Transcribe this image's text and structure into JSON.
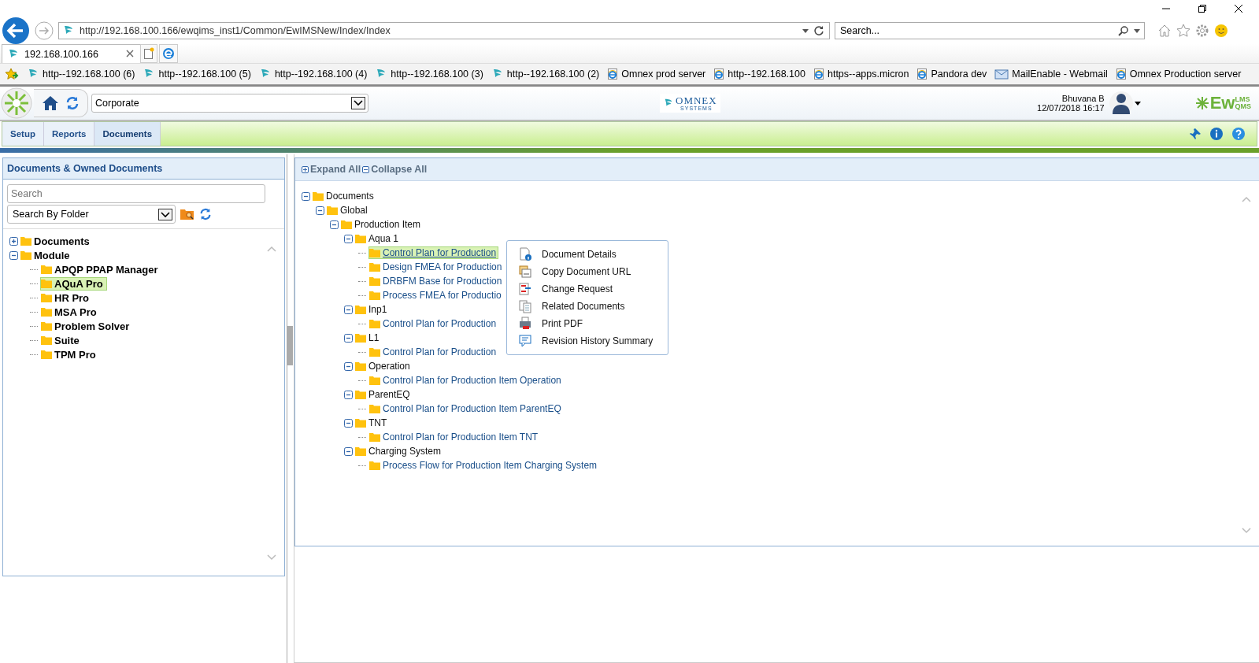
{
  "browser": {
    "address": "http://192.168.100.166/ewqims_inst1/Common/EwIMSNew/Index/Index",
    "search": {
      "placeholder": "Search..."
    },
    "tab": {
      "title": "192.168.100.166",
      "selected": true
    },
    "favorites": [
      {
        "label": "http--192.168.100 (6)",
        "kind": "site"
      },
      {
        "label": "http--192.168.100 (5)",
        "kind": "site"
      },
      {
        "label": "http--192.168.100 (4)",
        "kind": "site"
      },
      {
        "label": "http--192.168.100 (3)",
        "kind": "site"
      },
      {
        "label": "http--192.168.100 (2)",
        "kind": "site"
      },
      {
        "label": "Omnex prod server",
        "kind": "page"
      },
      {
        "label": "http--192.168.100",
        "kind": "page"
      },
      {
        "label": "https--apps.micron",
        "kind": "page"
      },
      {
        "label": "Pandora dev",
        "kind": "page"
      },
      {
        "label": "MailEnable - Webmail",
        "kind": "mail"
      },
      {
        "label": "Omnex Production server",
        "kind": "page"
      }
    ]
  },
  "header": {
    "company": "OMNEX",
    "company_sub": "SYSTEMS",
    "product": "Ew",
    "product_sup": "LMS",
    "product_sub": "QMS",
    "site": "Corporate",
    "user": "Bhuvana B",
    "datetime": "12/07/2018 16:17"
  },
  "nav": [
    {
      "label": "Setup",
      "selected": false
    },
    {
      "label": "Reports",
      "selected": false
    },
    {
      "label": "Documents",
      "selected": true
    }
  ],
  "left_panel": {
    "title": "Documents & Owned Documents",
    "search": {
      "placeholder": "Search"
    },
    "filter": "Search By Folder",
    "tree": [
      {
        "label": "Documents",
        "expanded": false
      },
      {
        "label": "Module",
        "expanded": true,
        "children": [
          {
            "label": "APQP PPAP Manager",
            "selected": false
          },
          {
            "label": "AQuA Pro",
            "selected": true
          },
          {
            "label": "HR Pro",
            "selected": false
          },
          {
            "label": "MSA Pro",
            "selected": false
          },
          {
            "label": "Problem Solver",
            "selected": false
          },
          {
            "label": "Suite",
            "selected": false
          },
          {
            "label": "TPM Pro",
            "selected": false
          }
        ]
      }
    ]
  },
  "main_panel": {
    "expand_all": "Expand All",
    "collapse_all": "Collapse All",
    "tree": [
      {
        "label": "Documents",
        "kind": "folder",
        "expanded": true,
        "children": [
          {
            "label": "Global",
            "kind": "folder",
            "expanded": true,
            "children": [
              {
                "label": "Production Item",
                "kind": "folder",
                "expanded": true,
                "children": [
                  {
                    "label": "Aqua 1",
                    "kind": "folder",
                    "expanded": true,
                    "children": [
                      {
                        "label": "Control Plan for Production",
                        "kind": "document",
                        "selected": true
                      },
                      {
                        "label": "Design FMEA for Production",
                        "kind": "document",
                        "selected": false
                      },
                      {
                        "label": "DRBFM Base for Production",
                        "kind": "document",
                        "selected": false
                      },
                      {
                        "label": "Process FMEA for Productio",
                        "kind": "document",
                        "selected": false
                      }
                    ]
                  },
                  {
                    "label": "Inp1",
                    "kind": "folder",
                    "expanded": true,
                    "children": [
                      {
                        "label": "Control Plan for Production",
                        "kind": "document",
                        "selected": false
                      }
                    ]
                  },
                  {
                    "label": "L1",
                    "kind": "folder",
                    "expanded": true,
                    "children": [
                      {
                        "label": "Control Plan for Production",
                        "kind": "document",
                        "selected": false
                      }
                    ]
                  },
                  {
                    "label": "Operation",
                    "kind": "folder",
                    "expanded": true,
                    "children": [
                      {
                        "label": "Control Plan for Production Item Operation",
                        "kind": "document",
                        "selected": false
                      }
                    ]
                  },
                  {
                    "label": "ParentEQ",
                    "kind": "folder",
                    "expanded": true,
                    "children": [
                      {
                        "label": "Control Plan for Production Item ParentEQ",
                        "kind": "document",
                        "selected": false
                      }
                    ]
                  },
                  {
                    "label": "TNT",
                    "kind": "folder",
                    "expanded": true,
                    "children": [
                      {
                        "label": "Control Plan for Production Item TNT",
                        "kind": "document",
                        "selected": false
                      }
                    ]
                  },
                  {
                    "label": "Charging System",
                    "kind": "folder",
                    "expanded": true,
                    "children": [
                      {
                        "label": "Process Flow for Production Item Charging System",
                        "kind": "document",
                        "selected": false
                      }
                    ]
                  }
                ]
              }
            ]
          }
        ]
      }
    ]
  },
  "context_menu": [
    "Document Details",
    "Copy Document URL",
    "Change Request",
    "Related Documents",
    "Print PDF",
    "Revision History Summary"
  ]
}
